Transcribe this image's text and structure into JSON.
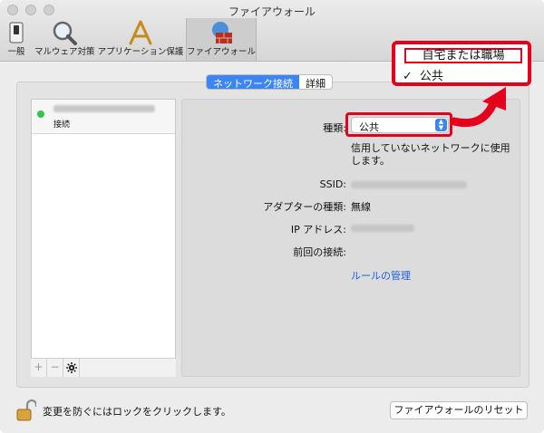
{
  "window": {
    "title": "ファイアウォール"
  },
  "toolbar": {
    "items": [
      {
        "label": "一般",
        "icon": "switch-icon"
      },
      {
        "label": "マルウェア対策",
        "icon": "magnifier-icon"
      },
      {
        "label": "アプリケーション保護",
        "icon": "app-store-icon"
      },
      {
        "label": "ファイアウォール",
        "icon": "firewall-icon",
        "active": true
      }
    ]
  },
  "popup_menu": {
    "options": [
      {
        "label": "自宅または職場",
        "highlighted": true
      },
      {
        "label": "公共",
        "checked": true,
        "check": "✓"
      }
    ]
  },
  "tabs": {
    "items": [
      "ネットワーク接続",
      "詳細"
    ],
    "selected": "ネットワーク接続"
  },
  "network_list": {
    "items": [
      {
        "status": "接続",
        "status_color": "#2fc94a"
      }
    ],
    "bar": {
      "add": "+",
      "remove": "−",
      "gear_icon": "gear-icon"
    }
  },
  "detail": {
    "type_label": "種類:",
    "type_value": "公共",
    "type_description_line1": "信用していないネットワークに使用",
    "type_description_line2": "します。",
    "ssid_label": "SSID:",
    "adapter_label": "アダプターの種類:",
    "adapter_value": "無線",
    "ip_label": "IP アドレス:",
    "last_connection_label": "前回の接続:",
    "manage_rules_link": "ルールの管理"
  },
  "footer": {
    "lock_text": "変更を防ぐにはロックをクリックします。",
    "reset_button": "ファイアウォールのリセット"
  },
  "colors": {
    "accent": "#3c85f5",
    "highlight": "#e5001b",
    "link": "#1d5fe0"
  }
}
